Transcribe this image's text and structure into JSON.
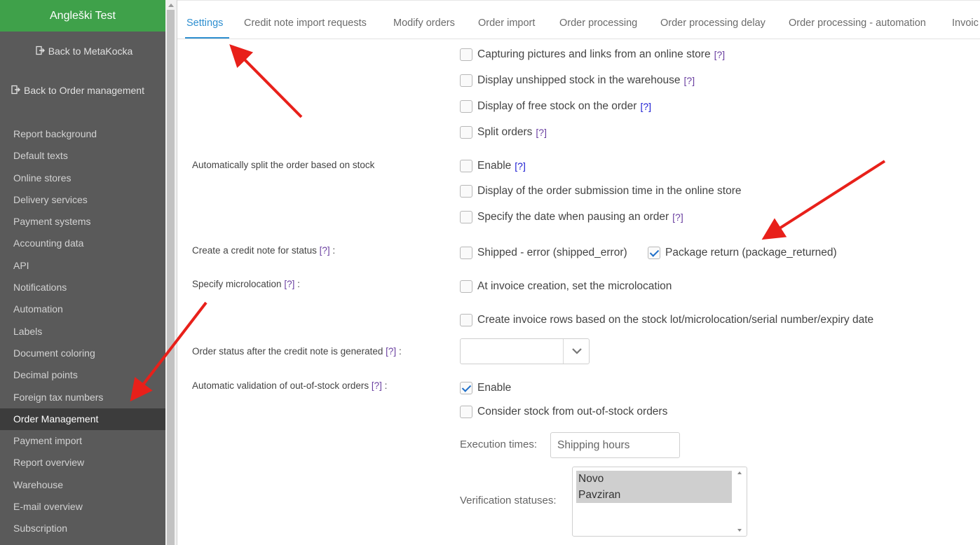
{
  "sidebar": {
    "app_title": "Angleški Test",
    "back_metakocka": "Back to MetaKocka",
    "back_order_management": "Back to Order management",
    "items": [
      {
        "label": "Report background"
      },
      {
        "label": "Default texts"
      },
      {
        "label": "Online stores"
      },
      {
        "label": "Delivery services"
      },
      {
        "label": "Payment systems"
      },
      {
        "label": "Accounting data"
      },
      {
        "label": "API"
      },
      {
        "label": "Notifications"
      },
      {
        "label": "Automation"
      },
      {
        "label": "Labels"
      },
      {
        "label": "Document coloring"
      },
      {
        "label": "Decimal points"
      },
      {
        "label": "Foreign tax numbers"
      },
      {
        "label": "Order Management",
        "active": true
      },
      {
        "label": "Payment import"
      },
      {
        "label": "Report overview"
      },
      {
        "label": "Warehouse"
      },
      {
        "label": "E-mail overview"
      },
      {
        "label": "Subscription"
      }
    ]
  },
  "tabs": [
    {
      "label": "Settings",
      "active": true
    },
    {
      "label": "Credit note import requests"
    },
    {
      "label": "Modify orders"
    },
    {
      "label": "Order import"
    },
    {
      "label": "Order processing"
    },
    {
      "label": "Order processing delay"
    },
    {
      "label": "Order processing - automation"
    },
    {
      "label": "Invoic"
    }
  ],
  "help_marker": "[?]",
  "colon": ":",
  "options": {
    "capturing_pictures": {
      "label": "Capturing pictures and links from an online store",
      "checked": false
    },
    "display_unshipped": {
      "label": "Display unshipped stock in the warehouse",
      "checked": false
    },
    "display_free_stock": {
      "label": "Display of free stock on the order",
      "checked": false
    },
    "split_orders": {
      "label": "Split orders",
      "checked": false
    }
  },
  "auto_split": {
    "label": "Automatically split the order based on stock",
    "enable": {
      "label": "Enable",
      "checked": false
    },
    "display_submission_time": {
      "label": "Display of the order submission time in the online store",
      "checked": false
    },
    "specify_pause_date": {
      "label": "Specify the date when pausing an order",
      "checked": false
    }
  },
  "credit_note_status": {
    "label": "Create a credit note for status",
    "shipped_error": {
      "label": "Shipped - error (shipped_error)",
      "checked": false
    },
    "package_returned": {
      "label": "Package return (package_returned)",
      "checked": true
    }
  },
  "microlocation": {
    "label": "Specify microlocation",
    "at_invoice_creation": {
      "label": "At invoice creation, set the microlocation",
      "checked": false
    },
    "invoice_rows": {
      "label": "Create invoice rows based on the stock lot/microlocation/serial number/expiry date",
      "checked": false
    }
  },
  "order_status_after_credit": {
    "label": "Order status after the credit note is generated",
    "selected": ""
  },
  "auto_validation": {
    "label": "Automatic validation of out-of-stock orders",
    "enable": {
      "label": "Enable",
      "checked": true
    },
    "consider_stock": {
      "label": "Consider stock from out-of-stock orders",
      "checked": false
    },
    "execution_times_label": "Execution times:",
    "execution_times_placeholder": "Shipping hours",
    "verification_statuses_label": "Verification statuses:",
    "verification_statuses": [
      "Novo",
      "Pavziran"
    ]
  },
  "colors": {
    "sidebar_bg": "#5a5a5a",
    "title_bar": "#3fa14a",
    "active_tab": "#2e8fd0",
    "annotation_arrow": "#e8201a"
  },
  "icons": {
    "back": "sign-out-icon",
    "select": "chevron-down-icon",
    "check": "checkmark-icon"
  }
}
